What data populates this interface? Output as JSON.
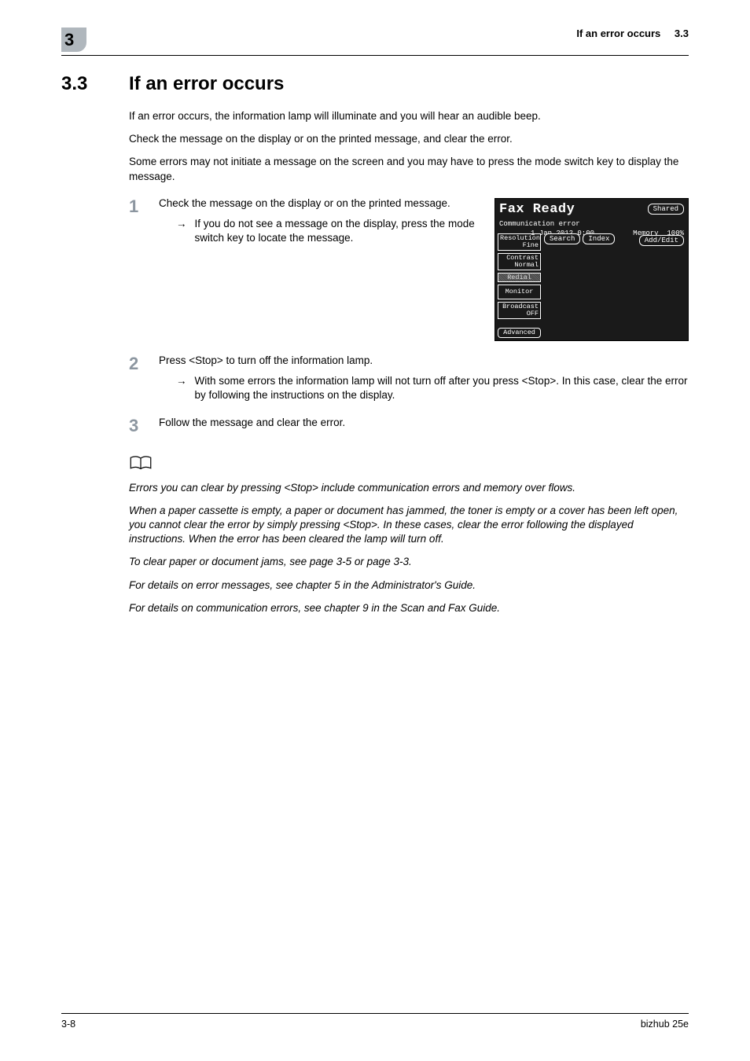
{
  "header": {
    "chapter": "3",
    "title": "If an error occurs",
    "section": "3.3"
  },
  "heading": {
    "number": "3.3",
    "title": "If an error occurs"
  },
  "intro": {
    "p1": "If an error occurs, the information lamp will illuminate and you will hear an audible beep.",
    "p2": "Check the message on the display or on the printed message, and clear the error.",
    "p3": "Some errors may not initiate a message on the screen and you may have to press the mode switch key to display the message."
  },
  "steps": {
    "s1": {
      "num": "1",
      "text": "Check the message on the display or on the printed message.",
      "bullet": "If you do not see a message on the display, press the mode switch key to locate the message."
    },
    "s2": {
      "num": "2",
      "text": "Press <Stop> to turn off the information lamp.",
      "bullet": "With some errors the information lamp will not turn off after you press <Stop>. In this case, clear the error by following the instructions on the display."
    },
    "s3": {
      "num": "3",
      "text": "Follow the message and clear the error."
    }
  },
  "fax": {
    "title": "Fax Ready",
    "status": "Communication error",
    "date": "1 Jan 2012  0:00",
    "memory_label": "Memory",
    "memory_val": "100%",
    "shared": "Shared",
    "resolution": "Resolution",
    "resolution_val": "Fine",
    "contrast": "Contrast",
    "contrast_val": "Normal",
    "redial": "Redial",
    "monitor": "Monitor",
    "broadcast": "Broadcast",
    "broadcast_val": "OFF",
    "advanced": "Advanced",
    "search": "Search",
    "index": "Index",
    "addedit": "Add/Edit"
  },
  "notes": {
    "n1": "Errors you can clear by pressing <Stop> include communication errors and memory over flows.",
    "n2": "When a paper cassette is empty, a paper or document has jammed, the toner is empty or a cover has been left open, you cannot clear the error by simply pressing <Stop>. In these cases, clear the error following the displayed instructions. When the error has been cleared the lamp will turn off.",
    "n3": "To clear paper or document jams, see page 3-5 or page 3-3.",
    "n4": "For details on error messages, see chapter 5 in the Administrator's Guide.",
    "n5": "For details on communication errors, see chapter 9 in the Scan and Fax Guide."
  },
  "footer": {
    "page": "3-8",
    "product": "bizhub 25e"
  }
}
